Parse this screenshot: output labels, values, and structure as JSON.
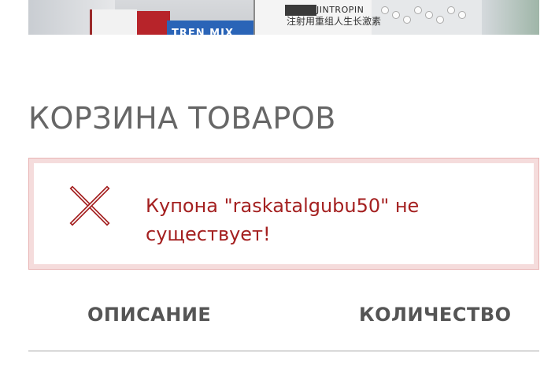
{
  "banner": {
    "brand_text": "JINTROPIN",
    "chinese_text": "注射用重组人生长激素",
    "mix_text": "TREN MIX"
  },
  "cart": {
    "title": "КОРЗИНА ТОВАРОВ"
  },
  "notice": {
    "icon": "close-x-icon",
    "message": "Купона \"raskatalgubu50\" не существует!",
    "text_color": "#a42020",
    "border_color": "#f5dcdc"
  },
  "table": {
    "columns": [
      "ОПИСАНИЕ",
      "КОЛИЧЕСТВО"
    ]
  }
}
